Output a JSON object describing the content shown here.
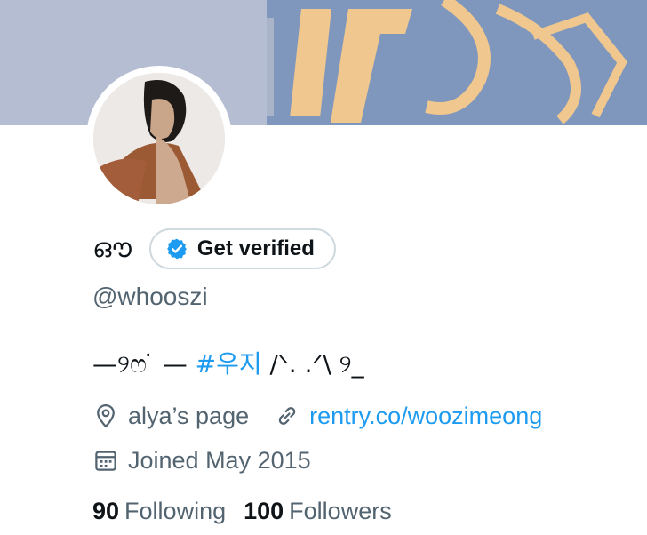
{
  "profile": {
    "display_name": "ഔ",
    "verify_label": "Get verified",
    "handle": "@whooszi",
    "bio_prefix": "—୨ෆ ̇ — ",
    "bio_hashtag": "#우지",
    "bio_suffix": " /ᐠ. .ᐟ\\ ୨_"
  },
  "meta": {
    "location": "alya’s page",
    "website": "rentry.co/woozimeong",
    "joined": "Joined May 2015"
  },
  "stats": {
    "following_count": "90",
    "following_label": "Following",
    "followers_count": "100",
    "followers_label": "Followers"
  },
  "icons": {
    "verify": "verified-badge-icon",
    "location": "location-pin-icon",
    "link": "link-icon",
    "calendar": "calendar-icon"
  },
  "colors": {
    "accent": "#1d9bf0",
    "secondary_text": "#536471",
    "primary_text": "#0f1419",
    "border": "#cfd9de"
  }
}
